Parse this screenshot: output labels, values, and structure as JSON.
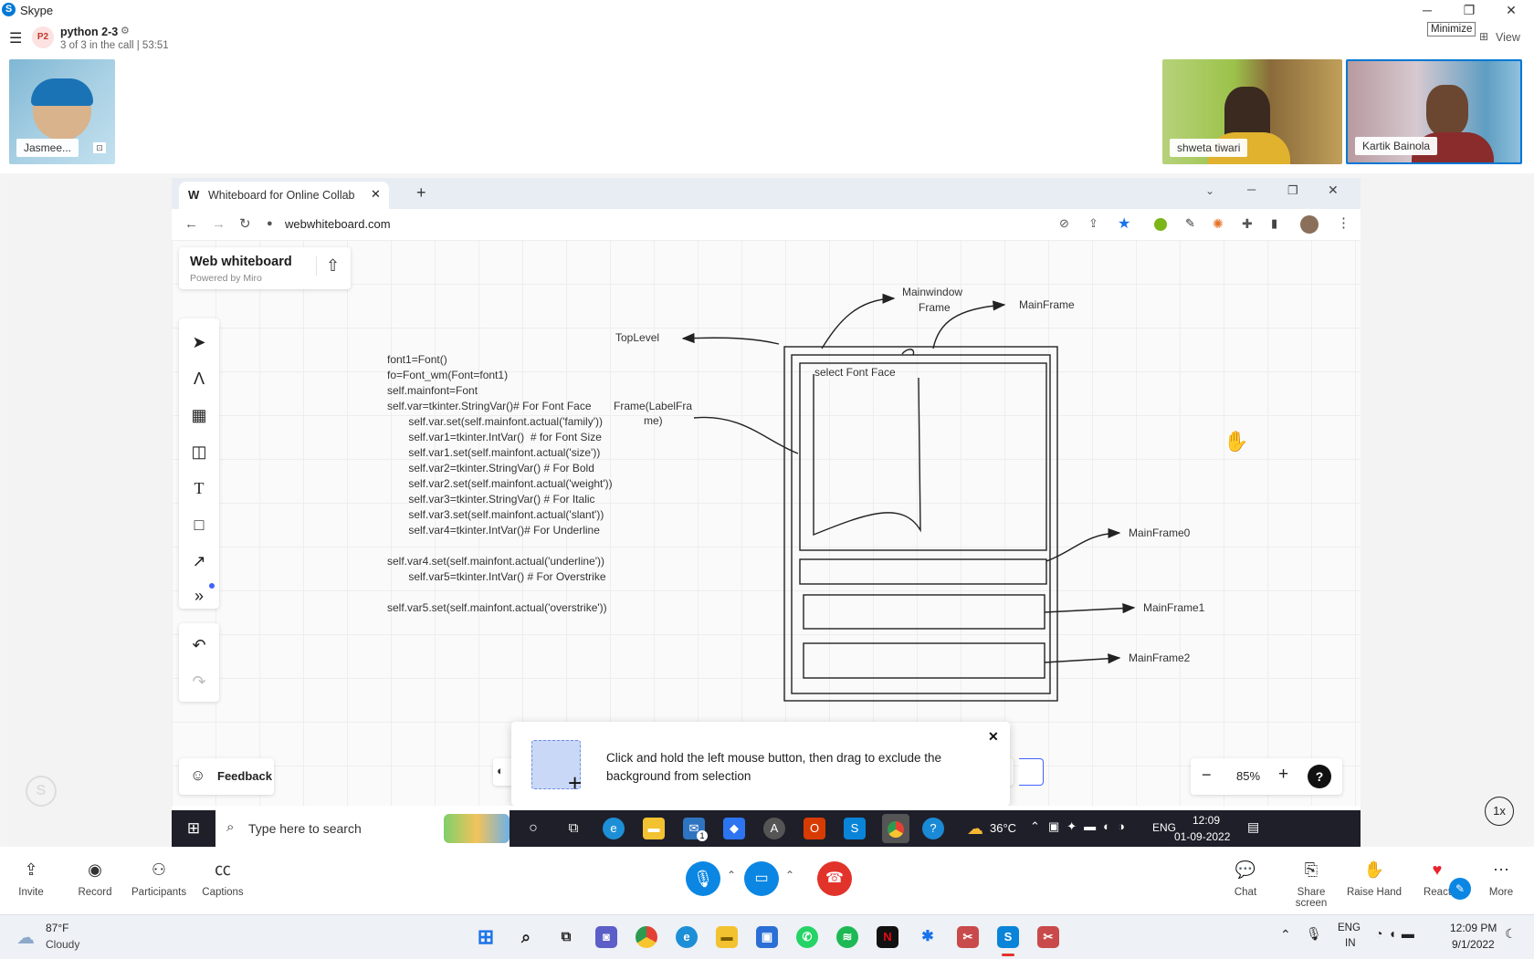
{
  "skype": {
    "app_title": "Skype",
    "call_avatar": "P2",
    "call_name": "python 2-3",
    "call_status": "3 of 3 in the call | 53:51",
    "tooltip": "Minimize",
    "view_label": "View"
  },
  "participants": [
    {
      "name": "Jasmee..."
    },
    {
      "name": "shweta tiwari"
    },
    {
      "name": "Kartik Bainola"
    }
  ],
  "browser": {
    "tab_title": "Whiteboard for Online Collabora",
    "url": "webwhiteboard.com"
  },
  "whiteboard": {
    "brand_title": "Web whiteboard",
    "brand_subtitle": "Powered by Miro",
    "feedback_label": "Feedback",
    "zoom_level": "85%",
    "speed_label": "1x",
    "code_lines": [
      "font1=Font()",
      "fo=Font_wm(Font=font1)",
      "self.mainfont=Font",
      "self.var=tkinter.StringVar()# For Font Face",
      "       self.var.set(self.mainfont.actual('family'))",
      "       self.var1=tkinter.IntVar()  # for Font Size",
      "       self.var1.set(self.mainfont.actual('size'))",
      "       self.var2=tkinter.StringVar() # For Bold",
      "       self.var2.set(self.mainfont.actual('weight'))",
      "       self.var3=tkinter.StringVar() # For Italic",
      "       self.var3.set(self.mainfont.actual('slant'))",
      "       self.var4=tkinter.IntVar()# For Underline",
      "",
      "self.var4.set(self.mainfont.actual('underline'))",
      "       self.var5=tkinter.IntVar() # For Overstrike",
      "",
      "self.var5.set(self.mainfont.actual('overstrike'))"
    ],
    "diagram_labels": {
      "mainwindow_frame_1": "Mainwindow",
      "mainwindow_frame_2": "Frame",
      "mainframe": "MainFrame",
      "toplevel": "TopLevel",
      "select_font_face": "select Font Face",
      "labelframe_1": "Frame(LabelFra",
      "labelframe_2": "me)",
      "mainframe0": "MainFrame0",
      "mainframe1": "MainFrame1",
      "mainframe2": "MainFrame2"
    },
    "hint_text": "Click and hold the left mouse button, then drag to exclude the background from selection"
  },
  "inner_taskbar": {
    "search_placeholder": "Type here to search",
    "temperature": "36°C",
    "lang": "ENG",
    "time": "12:09",
    "date": "01-09-2022",
    "mail_badge": "1"
  },
  "call_controls": {
    "invite": "Invite",
    "record": "Record",
    "participants": "Participants",
    "captions": "Captions",
    "chat": "Chat",
    "share_screen": "Share screen",
    "raise_hand": "Raise Hand",
    "react": "React",
    "more": "More"
  },
  "windows_taskbar": {
    "weather_temp": "87°F",
    "weather_desc": "Cloudy",
    "lang_1": "ENG",
    "lang_2": "IN",
    "time": "12:09 PM",
    "date": "9/1/2022"
  },
  "colors": {
    "skype_blue": "#0078d4",
    "hangup_red": "#e2332b",
    "taskbar_dark": "#1f1f2a"
  }
}
